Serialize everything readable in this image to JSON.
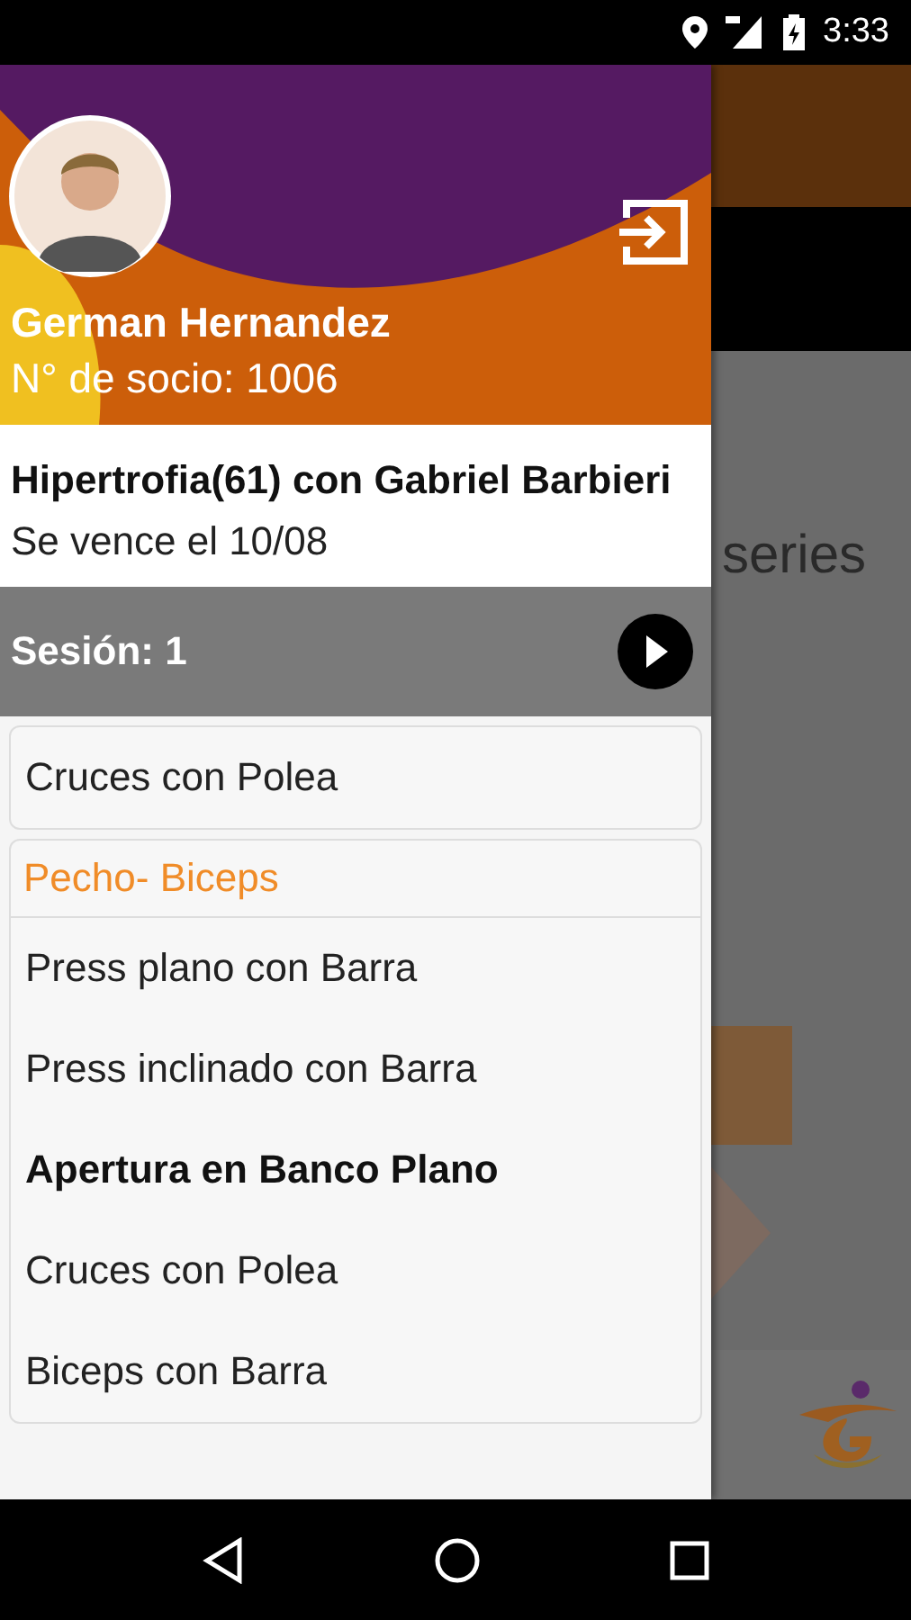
{
  "status_bar": {
    "time": "3:33"
  },
  "background": {
    "text": "series"
  },
  "profile": {
    "name": "German Hernandez",
    "member_number": "N° de socio: 1006"
  },
  "plan": {
    "title": "Hipertrofia(61) con Gabriel Barbieri",
    "expiry": "Se vence el 10/08"
  },
  "session": {
    "label": "Sesión: 1"
  },
  "groups": [
    {
      "items": [
        {
          "label": "Cruces con Polea",
          "selected": false
        }
      ]
    },
    {
      "title": "Pecho- Biceps",
      "items": [
        {
          "label": "Press plano con Barra",
          "selected": false
        },
        {
          "label": "Press inclinado con Barra",
          "selected": false
        },
        {
          "label": "Apertura en Banco Plano",
          "selected": true
        },
        {
          "label": "Cruces con Polea",
          "selected": false
        },
        {
          "label": "Biceps con Barra",
          "selected": false
        }
      ]
    }
  ]
}
